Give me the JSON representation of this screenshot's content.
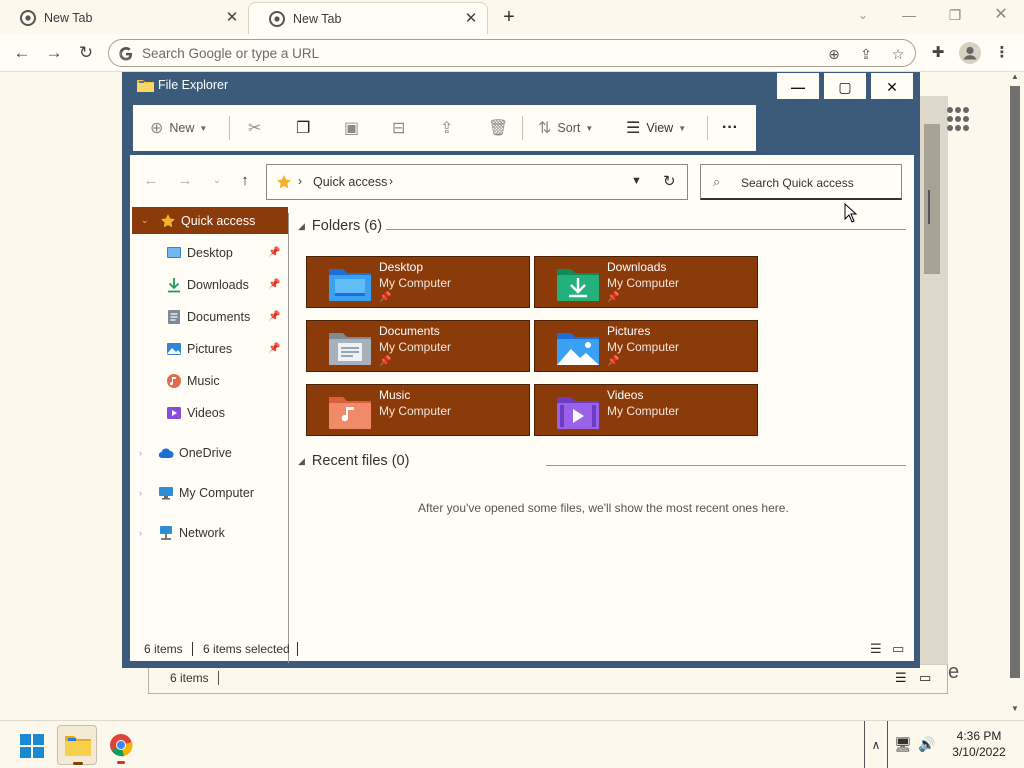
{
  "browser": {
    "tabs": [
      {
        "title": "New Tab",
        "active": false
      },
      {
        "title": "New Tab",
        "active": true
      }
    ],
    "omnibox_placeholder": "Search Google or type a URL"
  },
  "explorer": {
    "title": "File Explorer",
    "commands": {
      "new_label": "New",
      "sort_label": "Sort",
      "view_label": "View",
      "more_label": "···"
    },
    "address": {
      "crumb": "Quick access"
    },
    "search_placeholder": "Search Quick access",
    "nav": {
      "quick_access": "Quick access",
      "pinned": [
        {
          "label": "Desktop",
          "icon": "desktop-icon",
          "pinned": true
        },
        {
          "label": "Downloads",
          "icon": "downloads-icon",
          "pinned": true
        },
        {
          "label": "Documents",
          "icon": "documents-icon",
          "pinned": true
        },
        {
          "label": "Pictures",
          "icon": "pictures-icon",
          "pinned": true
        },
        {
          "label": "Music",
          "icon": "music-icon",
          "pinned": false
        },
        {
          "label": "Videos",
          "icon": "videos-icon",
          "pinned": false
        }
      ],
      "onedrive": "OneDrive",
      "my_computer": "My Computer",
      "network": "Network"
    },
    "folders_header": "Folders (6)",
    "folders": [
      {
        "name": "Desktop",
        "location": "My Computer",
        "pinned": true
      },
      {
        "name": "Downloads",
        "location": "My Computer",
        "pinned": true
      },
      {
        "name": "Documents",
        "location": "My Computer",
        "pinned": true
      },
      {
        "name": "Pictures",
        "location": "My Computer",
        "pinned": true
      },
      {
        "name": "Music",
        "location": "My Computer",
        "pinned": false
      },
      {
        "name": "Videos",
        "location": "My Computer",
        "pinned": false
      }
    ],
    "recent_header": "Recent files (0)",
    "recent_empty": "After you've opened some files, we'll show the most recent ones here.",
    "status": {
      "items": "6 items",
      "selected": "6 items selected"
    },
    "selection_color": "#8b3a0a"
  },
  "background_window": {
    "status_items": "6 items",
    "partial_text": "e"
  },
  "taskbar": {
    "time": "4:36 PM",
    "date": "3/10/2022"
  }
}
